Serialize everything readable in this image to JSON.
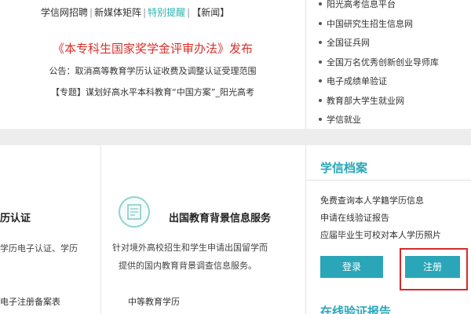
{
  "top_links": [
    "学信网招聘",
    "新媒体矩阵",
    "特别提醒",
    "【新闻】"
  ],
  "headline": "《本专科生国家奖学金评审办法》发布",
  "notice": "公告：取消高等教育学历认证收费及调整认证受理范围",
  "topic": "【专题】谋划好高水平本科教育“中国方案”_阳光高考",
  "side_links": [
    "阳光高考信息平台",
    "中国研究生招生信息网",
    "全国征兵网",
    "全国万名优秀创新创业导师库",
    "电子成绩单验证",
    "教育部大学生就业网",
    "学信就业"
  ],
  "card_left": {
    "title": "历认证",
    "desc": "学历电子认证、学历",
    "link": "电子注册备案表"
  },
  "card_middle": {
    "title": "出国教育背景信息服务",
    "desc_line1": "针对境外高校招生和学生申请出国留学而",
    "desc_line2": "提供的国内教育背景调查信息服务。",
    "link": "中等教育学历"
  },
  "archive": {
    "title": "学信档案",
    "items": [
      "免费查询本人学籍学历信息",
      "申请在线验证报告",
      "应届毕业生可校对本人学历照片"
    ],
    "login_label": "登录",
    "register_label": "注册"
  },
  "next_section_title": "在线验证报告",
  "colors": {
    "accent": "#2aa6b8",
    "headline_red": "#d9302a",
    "highlight_box": "#d62b2b"
  }
}
